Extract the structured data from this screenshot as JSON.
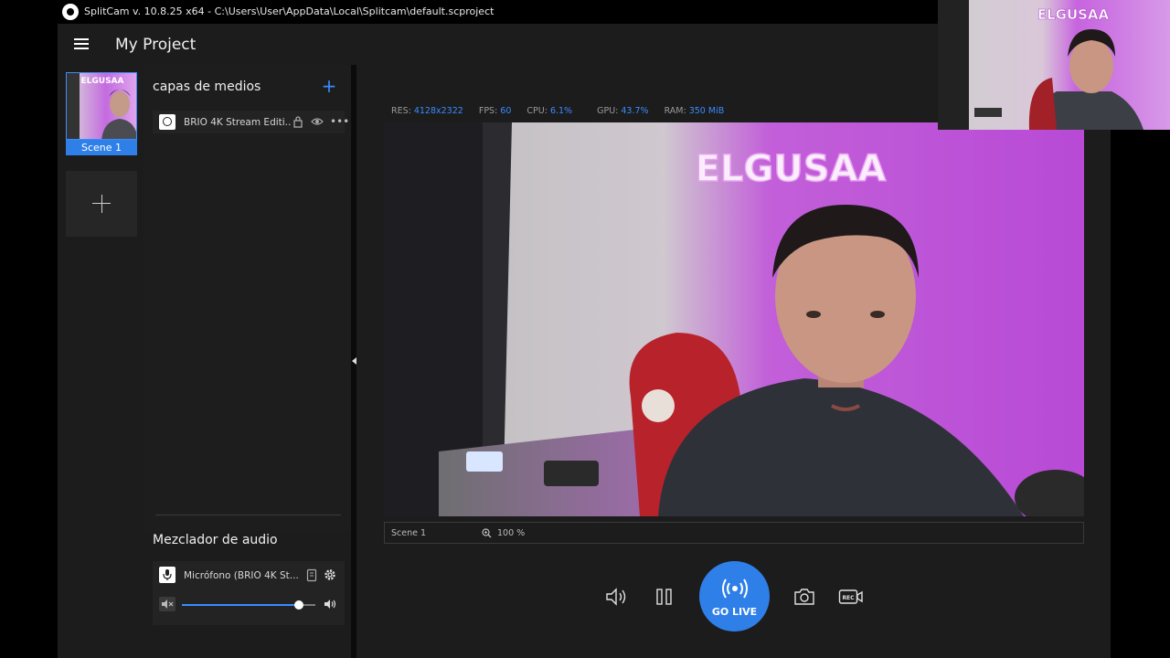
{
  "window": {
    "title": "SplitCam v. 10.8.25 x64 - C:\\Users\\User\\AppData\\Local\\Splitcam\\default.scproject"
  },
  "header": {
    "project_title": "My Project"
  },
  "scenes": [
    {
      "label": "Scene 1",
      "selected": true
    }
  ],
  "layers": {
    "title": "capas de medios",
    "items": [
      {
        "name": "BRIO 4K Stream Editi..."
      }
    ]
  },
  "audio_mixer": {
    "title": "Mezclador de audio",
    "device": "Micrófono (BRIO 4K St...",
    "volume": 0.88
  },
  "stats": {
    "res_label": "RES:",
    "res": "4128x2322",
    "fps_label": "FPS:",
    "fps": "60",
    "cpu_label": "CPU:",
    "cpu": "6.1%",
    "gpu_label": "GPU:",
    "gpu": "43.7%",
    "ram_label": "RAM:",
    "ram": "350 MiB"
  },
  "preview": {
    "scene_name": "Scene 1",
    "zoom": "100 %",
    "sign_text": "ELGUSAA"
  },
  "controls": {
    "go_live": "GO LIVE",
    "rec_badge": "REC"
  },
  "colors": {
    "accent": "#2f7fe8",
    "panel": "#1c1c1c",
    "background": "#000000"
  }
}
